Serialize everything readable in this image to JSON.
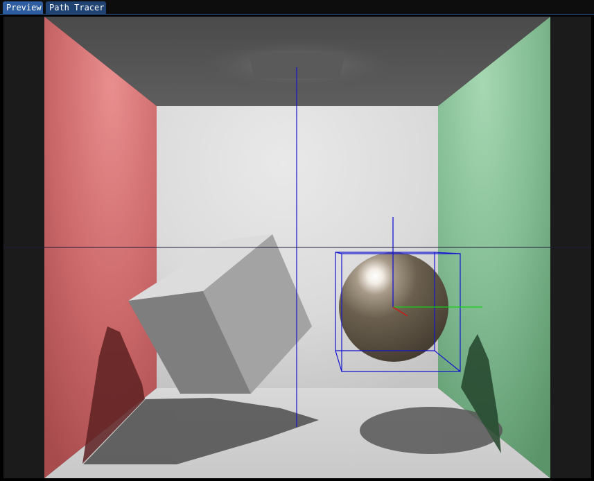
{
  "tabs": [
    {
      "label": "Preview",
      "active": true
    },
    {
      "label": "Path Tracer",
      "active": false
    }
  ],
  "colors": {
    "tab_active": "#2d5d9e",
    "tab_inactive": "#1f4272",
    "viewport_bg": "#1b1b1b",
    "left_wall": "#c25a5c",
    "right_wall": "#76b58a",
    "gizmo_blue": "#1414d0",
    "gizmo_green": "#18d018",
    "gizmo_red": "#d01818"
  },
  "scene": {
    "objects": [
      "cornell-box",
      "area-light",
      "rotated-cube",
      "metal-sphere"
    ],
    "selected": "metal-sphere"
  }
}
